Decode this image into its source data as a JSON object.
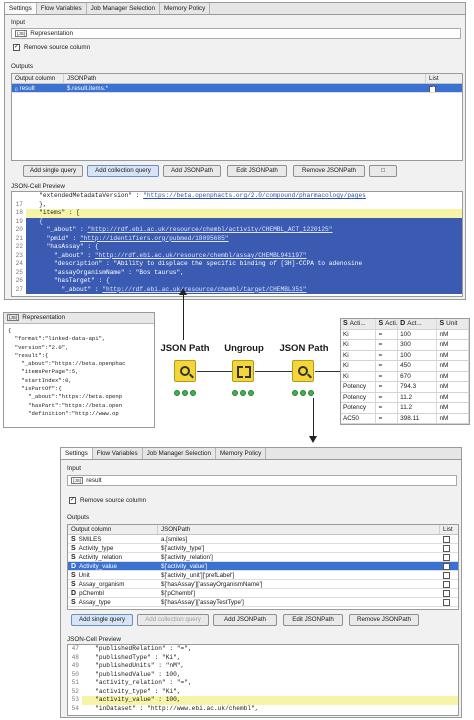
{
  "top_dialog": {
    "tabs": [
      "Settings",
      "Flow Variables",
      "Job Manager Selection",
      "Memory Policy"
    ],
    "input_label": "Input",
    "input_value": "Representation",
    "input_type_icon": "json-type-icon",
    "remove_source_label": "Remove source column",
    "remove_source_checked": true,
    "outputs_label": "Outputs",
    "columns": [
      "Output column",
      "JSONPath",
      "List"
    ],
    "rows": [
      {
        "name": "result",
        "path": "$.result.items.*",
        "list": true
      }
    ],
    "buttons": [
      "Add single query",
      "Add collection query",
      "Add JSONPath",
      "Edit JSONPath",
      "Remove JSONPath",
      "□"
    ],
    "preview_label": "JSON-Cell Preview",
    "preview_lines": [
      {
        "num": "",
        "text": "   \"extendedMetadataVersion\" : ",
        "url": "\"https://beta.openphacts.org/2.0/compound/pharmacology/pages",
        "style": "plain"
      },
      {
        "num": "17",
        "text": "   },",
        "url": "",
        "style": "plain"
      },
      {
        "num": "18",
        "text": "   \"items\" : [",
        "url": "",
        "style": "yellow"
      },
      {
        "num": "19",
        "text": "   {",
        "url": "",
        "style": "blue"
      },
      {
        "num": "20",
        "text": "     \"_about\" : ",
        "url": "\"http://rdf.ebi.ac.uk/resource/chembl/activity/CHEMBL_ACT_1220125\"",
        "style": "blue"
      },
      {
        "num": "21",
        "text": "     \"pmid\" : ",
        "url": "\"http://identifiers.org/pubmed/18095685\"",
        "style": "blue"
      },
      {
        "num": "22",
        "text": "     \"hasAssay\" : {",
        "url": "",
        "style": "blue"
      },
      {
        "num": "23",
        "text": "       \"_about\" : ",
        "url": "\"http://rdf.ebi.ac.uk/resource/chembl/assay/CHEMBL941197\"",
        "style": "blue"
      },
      {
        "num": "24",
        "text": "       \"description\" : \"Ability to displace the specific binding of [3H]-CCPA to adenosine",
        "url": "",
        "style": "blue"
      },
      {
        "num": "25",
        "text": "       \"assayOrganismName\" : \"Bos taurus\",",
        "url": "",
        "style": "blue"
      },
      {
        "num": "26",
        "text": "       \"hasTarget\" : {",
        "url": "",
        "style": "blue"
      },
      {
        "num": "27",
        "text": "         \"_about\" : ",
        "url": "\"http://rdf.ebi.ac.uk/resource/chembl/target/CHEMBL351\"",
        "style": "blue"
      }
    ]
  },
  "left_panel": {
    "header": "Representation",
    "lines": [
      "{",
      "  \"format\":\"linked-data-api\",",
      "  \"version\":\"2.0\",",
      "  \"result\":{",
      "    \"_about\":\"https://beta.openphac",
      "    \"itemsPerPage\":5,",
      "    \"startIndex\":0,",
      "    \"isPartOf\":{",
      "      \"_about\":\"https://beta.openp",
      "      \"hasPart\":\"https://beta.open",
      "      \"definition\":\"http://www.op"
    ]
  },
  "workflow": {
    "nodes": [
      {
        "title": "JSON Path",
        "icon": "json-path-icon"
      },
      {
        "title": "Ungroup",
        "icon": "ungroup-icon"
      },
      {
        "title": "JSON Path",
        "icon": "json-path-icon"
      }
    ]
  },
  "result_table": {
    "headers": [
      {
        "icon": "S",
        "label": "Acti..."
      },
      {
        "icon": "S",
        "label": "Acti..."
      },
      {
        "icon": "D",
        "label": "Act..."
      },
      {
        "icon": "S",
        "label": "Unit"
      }
    ],
    "rows": [
      [
        "Ki",
        "=",
        "100",
        "nM"
      ],
      [
        "Ki",
        "=",
        "300",
        "nM"
      ],
      [
        "Ki",
        "=",
        "100",
        "nM"
      ],
      [
        "Ki",
        "=",
        "450",
        "nM"
      ],
      [
        "Ki",
        "=",
        "670",
        "nM"
      ],
      [
        "Potency",
        "=",
        "794.3",
        "nM"
      ],
      [
        "Potency",
        "=",
        "11.2",
        "nM"
      ],
      [
        "Potency",
        "=",
        "11.2",
        "nM"
      ],
      [
        "AC50",
        "=",
        "398.11",
        "nM"
      ]
    ]
  },
  "bottom_dialog": {
    "tabs": [
      "Settings",
      "Flow Variables",
      "Job Manager Selection",
      "Memory Policy"
    ],
    "input_label": "Input",
    "input_value": "result",
    "remove_source_label": "Remove source column",
    "remove_source_checked": true,
    "outputs_label": "Outputs",
    "columns": [
      "Output column",
      "JSONPath",
      "List"
    ],
    "rows": [
      {
        "icon": "S",
        "name": "SMILES",
        "path": "a.[smiles]",
        "selected": false
      },
      {
        "icon": "S",
        "name": "Activity_type",
        "path": "$['activity_type']",
        "selected": false
      },
      {
        "icon": "S",
        "name": "Activity_relation",
        "path": "$['activity_relation']",
        "selected": false
      },
      {
        "icon": "D",
        "name": "Activity_value",
        "path": "$['activity_value']",
        "selected": true
      },
      {
        "icon": "S",
        "name": "Unit",
        "path": "$['activity_unit']['prefLabel']",
        "selected": false
      },
      {
        "icon": "S",
        "name": "Assay_organism",
        "path": "$['hasAssay']['assayOrganismName']",
        "selected": false
      },
      {
        "icon": "D",
        "name": "pChembl",
        "path": "$['pChembl']",
        "selected": false
      },
      {
        "icon": "S",
        "name": "Assay_type",
        "path": "$['hasAssay']['assayTestType']",
        "selected": false
      }
    ],
    "buttons": [
      "Add single query",
      "Add collection query",
      "Add JSONPath",
      "Edit JSONPath",
      "Remove JSONPath"
    ],
    "preview_label": "JSON-Cell Preview",
    "preview_lines": [
      {
        "num": "47",
        "text": "   \"publishedRelation\" : \"=\",",
        "style": "plain"
      },
      {
        "num": "48",
        "text": "   \"publishedType\" : \"Ki\",",
        "style": "plain"
      },
      {
        "num": "49",
        "text": "   \"publishedUnits\" : \"nM\",",
        "style": "plain"
      },
      {
        "num": "50",
        "text": "   \"publishedValue\" : 100,",
        "style": "plain"
      },
      {
        "num": "51",
        "text": "   \"activity_relation\" : \"=\",",
        "style": "plain"
      },
      {
        "num": "52",
        "text": "   \"activity_type\" : \"Ki\",",
        "style": "plain"
      },
      {
        "num": "53",
        "text": "   \"activity_value\" : 100,",
        "style": "yellow"
      },
      {
        "num": "54",
        "text": "   \"inDataset\" : \"http://www.ebi.ac.uk/chembl\",",
        "style": "plain"
      }
    ]
  }
}
